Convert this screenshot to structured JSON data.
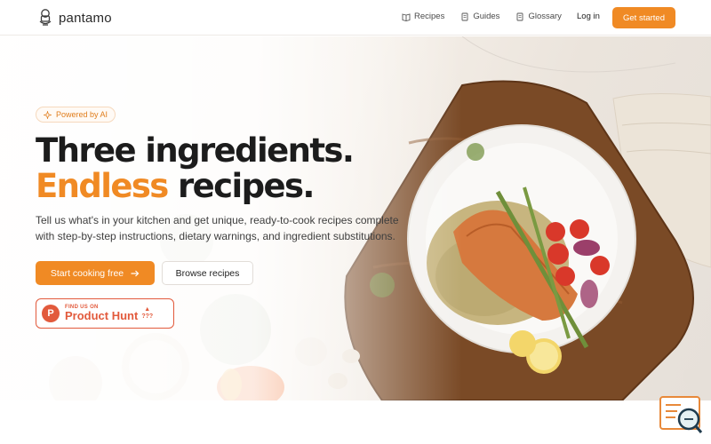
{
  "header": {
    "brand": "pantamo",
    "nav": [
      {
        "label": "Recipes",
        "icon": "book-icon"
      },
      {
        "label": "Guides",
        "icon": "document-icon"
      },
      {
        "label": "Glossary",
        "icon": "document-icon"
      }
    ],
    "login_label": "Log in",
    "cta_label": "Get started"
  },
  "hero": {
    "badge_label": "Powered by AI",
    "headline_line1": "Three ingredients.",
    "headline_accent": "Endless",
    "headline_line2_rest": " recipes.",
    "subtitle": "Tell us what's in your kitchen and get unique, ready-to-cook recipes complete with step-by-step instructions, dietary warnings, and ingredient substitutions.",
    "primary_button": "Start cooking free",
    "secondary_button": "Browse recipes",
    "product_hunt": {
      "small": "FIND US ON",
      "big": "Product Hunt",
      "count": "???",
      "logo_letter": "P"
    }
  },
  "colors": {
    "accent": "#f08a24",
    "product_hunt": "#e25a3c"
  }
}
